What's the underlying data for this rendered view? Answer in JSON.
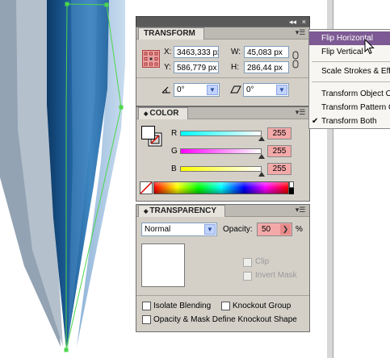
{
  "panels": {
    "transform": {
      "title": "TRANSFORM",
      "x_label": "X:",
      "x_value": "3463,333 px",
      "y_label": "Y:",
      "y_value": "586,779 px",
      "w_label": "W:",
      "w_value": "45,083 px",
      "h_label": "H:",
      "h_value": "286,44 px",
      "rotate_value": "0°",
      "shear_value": "0°"
    },
    "color": {
      "title": "COLOR",
      "r_label": "R",
      "r_value": "255",
      "g_label": "G",
      "g_value": "255",
      "b_label": "B",
      "b_value": "255"
    },
    "transparency": {
      "title": "TRANSPARENCY",
      "blend_mode": "Normal",
      "opacity_label": "Opacity:",
      "opacity_value": "50",
      "opacity_unit": "%",
      "clip_label": "Clip",
      "invert_mask_label": "Invert Mask",
      "isolate_blending_label": "Isolate Blending",
      "knockout_group_label": "Knockout Group",
      "opacity_mask_label": "Opacity & Mask Define Knockout Shape"
    }
  },
  "title_strip": {
    "collapse": "◂◂",
    "close": "×"
  },
  "flyout_menu": {
    "items": [
      {
        "label": "Flip Horizontal",
        "highlighted": true
      },
      {
        "label": "Flip Vertical"
      },
      {
        "label": "Scale Strokes & Effects"
      },
      {
        "label": "Transform Object Only"
      },
      {
        "label": "Transform Pattern Only"
      },
      {
        "label": "Transform Both",
        "checked": true
      }
    ],
    "checkmark": "✔"
  },
  "icons": {
    "panel_menu": "menu-lines-icon",
    "dropdown": "chevron-down-icon",
    "link": "chain-link-icon",
    "reference_point": "reference-point-grid-icon",
    "rotate": "rotate-angle-icon",
    "shear": "shear-angle-icon",
    "fill_stroke": "fill-stroke-swatch-icon",
    "none_swatch": "none-swatch-icon",
    "cursor": "mouse-pointer-icon"
  },
  "colors": {
    "panel_bg": "#d4d0c8",
    "field_highlight": "#f4a9a9",
    "menu_highlight": "#7d5a94",
    "selection_path": "#4cd64c",
    "shape_blue": "#2f6fa8"
  }
}
